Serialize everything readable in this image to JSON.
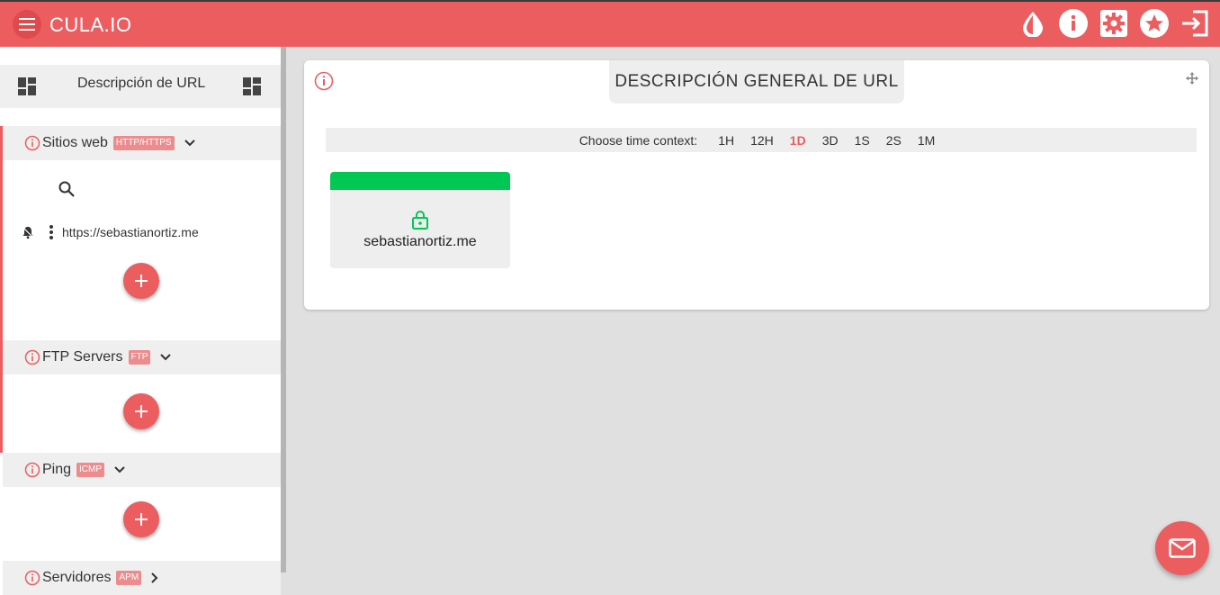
{
  "app": {
    "brand": "CULA.IO"
  },
  "topbar": {
    "icons": [
      "drop-icon",
      "info-icon",
      "settings-icon",
      "star-icon",
      "logout-icon"
    ]
  },
  "sidebar": {
    "header_title": "Descripción de URL",
    "sections": [
      {
        "label": "Sitios web",
        "badge": "HTTP/HTTPS",
        "expanded": true,
        "items": [
          {
            "url": "https://sebastianortiz.me"
          }
        ]
      },
      {
        "label": "FTP Servers",
        "badge": "FTP",
        "expanded": true,
        "items": []
      },
      {
        "label": "Ping",
        "badge": "ICMP",
        "expanded": true,
        "items": []
      },
      {
        "label": "Servidores",
        "badge": "APM",
        "expanded": false,
        "items": []
      }
    ]
  },
  "main": {
    "card_title": "DESCRIPCIÓN GENERAL DE URL",
    "time_context_label": "Choose time context:",
    "time_options": [
      "1H",
      "12H",
      "1D",
      "3D",
      "1S",
      "2S",
      "1M"
    ],
    "time_selected": "1D",
    "sites": [
      {
        "name": "sebastianortiz.me",
        "status_color": "#00c853"
      }
    ]
  },
  "colors": {
    "accent": "#ec5d60",
    "ok": "#00c853"
  }
}
